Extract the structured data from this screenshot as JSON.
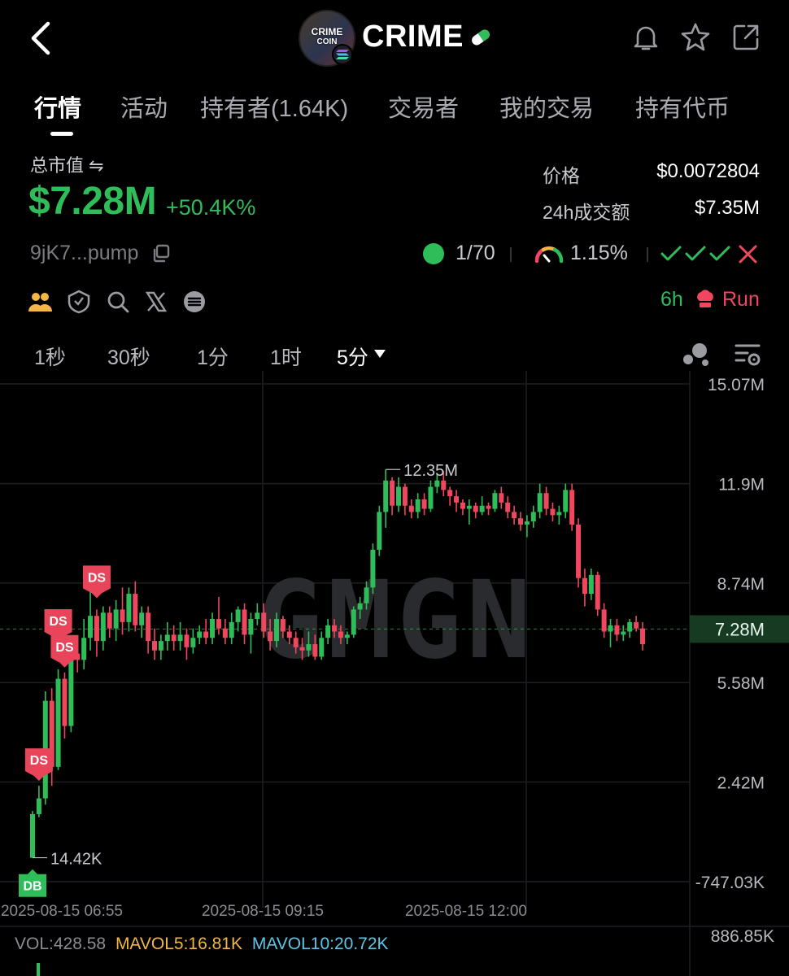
{
  "header": {
    "token_name": "CRIME",
    "avatar_text_line1": "CRIME",
    "avatar_text_line2": "COIN",
    "icons": [
      "back-arrow-icon",
      "solana-icon",
      "pill-icon",
      "bell-icon",
      "star-icon",
      "share-icon"
    ]
  },
  "tabs": [
    {
      "label": "行情",
      "active": true
    },
    {
      "label": "活动"
    },
    {
      "label": "持有者(1.64K)"
    },
    {
      "label": "交易者"
    },
    {
      "label": "我的交易"
    },
    {
      "label": "持有代币"
    }
  ],
  "market": {
    "mc_label": "总市值 ⇋",
    "mc_value": "$7.28M",
    "mc_change": "+50.4K%",
    "price_label": "价格",
    "price_value": "$0.0072804",
    "vol_label": "24h成交额",
    "vol_value": "$7.35M",
    "address": "9jK7...pump",
    "holders_ratio": "1/70",
    "gauge_value": "1.15%",
    "checks": "✓✓✓✕",
    "age": "6h",
    "run_label": "Run"
  },
  "social_icons": [
    "community-icon",
    "shield-icon",
    "search-icon",
    "x-twitter-icon",
    "website-icon"
  ],
  "intervals": [
    {
      "label": "1秒"
    },
    {
      "label": "30秒"
    },
    {
      "label": "1分"
    },
    {
      "label": "1时"
    },
    {
      "label": "5分",
      "active": true
    }
  ],
  "colors": {
    "up": "#2fbd5a",
    "down": "#f0465e",
    "accent_green": "#2fbd5a"
  },
  "chart_data": {
    "type": "candlestick",
    "watermark": "GMGN",
    "y_ticks": [
      "15.07M",
      "11.9M",
      "8.74M",
      "5.58M",
      "2.42M",
      "-747.03K"
    ],
    "y_tick_values": [
      15.07,
      11.9,
      8.74,
      5.58,
      2.42,
      -0.747
    ],
    "ylim": [
      -0.747,
      15.07
    ],
    "current_value_label": "7.28M",
    "current_value": 7.28,
    "x_ticks": [
      "2025-08-15 06:55",
      "2025-08-15 09:15",
      "2025-08-15 12:00"
    ],
    "max_annotation": {
      "label": "12.35M",
      "value": 12.35
    },
    "min_annotation": {
      "label": "14.42K",
      "value": 0.0144
    },
    "markers": [
      {
        "label": "DS",
        "candle": 1,
        "kind": "sell"
      },
      {
        "label": "DS",
        "candle": 4,
        "kind": "sell"
      },
      {
        "label": "DS",
        "candle": 5,
        "kind": "sell"
      },
      {
        "label": "DS",
        "candle": 10,
        "kind": "sell"
      },
      {
        "label": "DB",
        "candle": 0,
        "kind": "buy"
      }
    ],
    "candles_ohlc_millions": [
      [
        0.01,
        1.5,
        0.01,
        1.4
      ],
      [
        1.4,
        2.3,
        1.3,
        1.9
      ],
      [
        1.9,
        5.3,
        1.7,
        5.0
      ],
      [
        5.0,
        5.4,
        2.3,
        2.9
      ],
      [
        2.9,
        6.0,
        2.8,
        5.7
      ],
      [
        5.7,
        5.9,
        3.8,
        4.2
      ],
      [
        4.2,
        6.7,
        4.0,
        6.5
      ],
      [
        6.5,
        6.9,
        5.9,
        6.3
      ],
      [
        6.3,
        7.6,
        6.0,
        7.0
      ],
      [
        7.0,
        8.9,
        6.6,
        7.7
      ],
      [
        7.7,
        7.9,
        6.4,
        6.9
      ],
      [
        6.9,
        8.0,
        6.6,
        7.8
      ],
      [
        7.8,
        8.0,
        7.0,
        7.3
      ],
      [
        7.3,
        8.2,
        6.9,
        7.9
      ],
      [
        7.9,
        8.6,
        7.1,
        7.5
      ],
      [
        7.5,
        8.6,
        7.2,
        8.4
      ],
      [
        8.4,
        8.8,
        7.2,
        7.4
      ],
      [
        7.4,
        8.0,
        7.0,
        7.8
      ],
      [
        7.8,
        8.0,
        6.5,
        6.9
      ],
      [
        6.9,
        7.3,
        6.3,
        6.6
      ],
      [
        6.6,
        7.1,
        6.3,
        6.9
      ],
      [
        6.9,
        7.5,
        6.6,
        7.1
      ],
      [
        7.1,
        7.4,
        6.6,
        6.9
      ],
      [
        6.9,
        7.5,
        6.6,
        7.1
      ],
      [
        7.1,
        7.3,
        6.3,
        6.7
      ],
      [
        6.7,
        7.3,
        6.5,
        7.0
      ],
      [
        7.0,
        7.4,
        6.8,
        7.2
      ],
      [
        7.2,
        7.6,
        6.8,
        7.0
      ],
      [
        7.0,
        7.8,
        6.8,
        7.6
      ],
      [
        7.6,
        8.3,
        7.1,
        7.3
      ],
      [
        7.3,
        7.6,
        6.8,
        7.0
      ],
      [
        7.0,
        7.8,
        6.8,
        7.5
      ],
      [
        7.5,
        8.0,
        7.2,
        7.9
      ],
      [
        7.9,
        8.1,
        6.8,
        7.1
      ],
      [
        7.1,
        7.8,
        6.5,
        7.6
      ],
      [
        7.6,
        8.1,
        7.4,
        7.8
      ],
      [
        7.8,
        8.1,
        7.0,
        7.2
      ],
      [
        7.2,
        7.6,
        6.6,
        6.9
      ],
      [
        6.9,
        7.8,
        6.7,
        7.6
      ],
      [
        7.6,
        7.7,
        7.0,
        7.2
      ],
      [
        7.2,
        7.4,
        6.8,
        7.0
      ],
      [
        7.0,
        7.2,
        6.5,
        6.7
      ],
      [
        6.7,
        7.0,
        6.3,
        6.6
      ],
      [
        6.6,
        7.2,
        6.4,
        6.8
      ],
      [
        6.8,
        7.1,
        6.3,
        6.4
      ],
      [
        6.4,
        7.2,
        6.3,
        7.0
      ],
      [
        7.0,
        7.6,
        6.8,
        7.4
      ],
      [
        7.4,
        7.6,
        7.0,
        7.2
      ],
      [
        7.2,
        7.4,
        6.8,
        7.0
      ],
      [
        7.0,
        7.2,
        6.8,
        7.1
      ],
      [
        7.1,
        8.0,
        7.0,
        7.9
      ],
      [
        7.9,
        8.3,
        7.6,
        8.1
      ],
      [
        8.1,
        8.8,
        7.9,
        8.6
      ],
      [
        8.6,
        10.0,
        8.4,
        9.8
      ],
      [
        9.8,
        11.2,
        9.6,
        11.0
      ],
      [
        11.0,
        12.35,
        10.5,
        12.0
      ],
      [
        12.0,
        12.1,
        10.9,
        11.2
      ],
      [
        11.2,
        12.1,
        11.0,
        11.8
      ],
      [
        11.8,
        11.9,
        10.9,
        11.2
      ],
      [
        11.2,
        11.4,
        10.8,
        11.0
      ],
      [
        11.0,
        11.6,
        10.8,
        11.4
      ],
      [
        11.4,
        11.6,
        10.9,
        11.1
      ],
      [
        11.1,
        12.0,
        11.0,
        11.8
      ],
      [
        11.8,
        12.2,
        11.6,
        12.0
      ],
      [
        12.0,
        12.3,
        11.5,
        11.7
      ],
      [
        11.7,
        11.8,
        11.2,
        11.5
      ],
      [
        11.5,
        11.7,
        11.0,
        11.3
      ],
      [
        11.3,
        11.4,
        10.9,
        11.1
      ],
      [
        11.1,
        11.4,
        10.6,
        11.2
      ],
      [
        11.2,
        11.3,
        10.8,
        11.0
      ],
      [
        11.0,
        11.5,
        10.9,
        11.2
      ],
      [
        11.2,
        11.3,
        10.9,
        11.1
      ],
      [
        11.1,
        11.7,
        11.0,
        11.6
      ],
      [
        11.6,
        11.8,
        11.1,
        11.3
      ],
      [
        11.3,
        11.5,
        10.8,
        11.0
      ],
      [
        11.0,
        11.2,
        10.6,
        10.8
      ],
      [
        10.8,
        11.0,
        10.4,
        10.6
      ],
      [
        10.6,
        10.9,
        10.2,
        10.7
      ],
      [
        10.7,
        11.2,
        10.5,
        11.0
      ],
      [
        11.0,
        11.9,
        10.8,
        11.6
      ],
      [
        11.6,
        11.8,
        10.9,
        11.1
      ],
      [
        11.1,
        11.3,
        10.7,
        10.9
      ],
      [
        10.9,
        11.2,
        10.6,
        11.0
      ],
      [
        11.0,
        11.9,
        10.8,
        11.7
      ],
      [
        11.7,
        11.9,
        10.4,
        10.6
      ],
      [
        10.6,
        10.8,
        8.6,
        8.9
      ],
      [
        8.9,
        9.2,
        8.0,
        8.4
      ],
      [
        8.4,
        9.2,
        8.2,
        9.0
      ],
      [
        9.0,
        9.1,
        7.7,
        7.9
      ],
      [
        7.9,
        8.1,
        7.0,
        7.2
      ],
      [
        7.2,
        7.6,
        6.7,
        7.4
      ],
      [
        7.4,
        7.6,
        6.9,
        7.1
      ],
      [
        7.1,
        7.4,
        6.9,
        7.2
      ],
      [
        7.2,
        7.6,
        7.0,
        7.5
      ],
      [
        7.5,
        7.7,
        7.2,
        7.3
      ],
      [
        7.3,
        7.5,
        6.6,
        6.8
      ]
    ]
  },
  "volume": {
    "vol_label": "VOL:428.58",
    "mavol5_label": "MAVOL5:16.81K",
    "mavol10_label": "MAVOL10:20.72K",
    "axis_label": "886.85K",
    "mavol5_color": "#f5b743",
    "mavol10_color": "#5fc6e8"
  }
}
